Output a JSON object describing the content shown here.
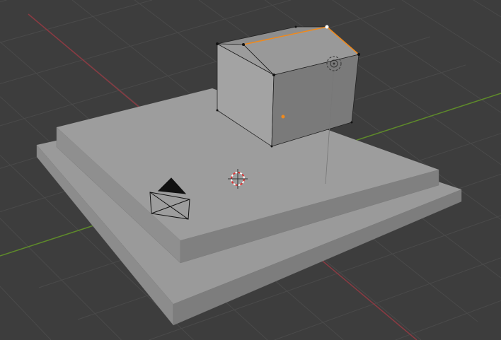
{
  "viewport": {
    "mode": "edit-mode",
    "colors": {
      "background": "#3d3d3d",
      "grid": "#4a4a4a",
      "x_axis": "#8a3a42",
      "y_axis": "#5e8a2a",
      "selection": "#f08a1c",
      "active_vertex": "#ffffff",
      "vertex": "#111111"
    }
  }
}
